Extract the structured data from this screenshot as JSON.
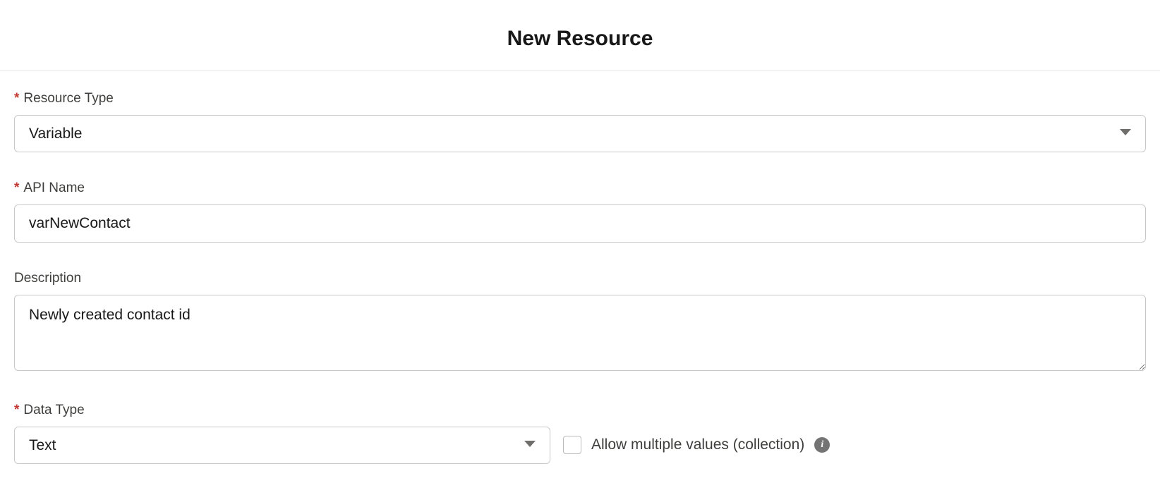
{
  "dialog": {
    "title": "New Resource"
  },
  "fields": {
    "resourceType": {
      "label": "Resource Type",
      "value": "Variable",
      "required": true
    },
    "apiName": {
      "label": "API Name",
      "value": "varNewContact",
      "required": true
    },
    "description": {
      "label": "Description",
      "value": "Newly created contact id",
      "required": false
    },
    "dataType": {
      "label": "Data Type",
      "value": "Text",
      "required": true
    },
    "allowMultiple": {
      "label": "Allow multiple values (collection)",
      "checked": false
    }
  },
  "symbols": {
    "required": "*",
    "info": "i"
  }
}
